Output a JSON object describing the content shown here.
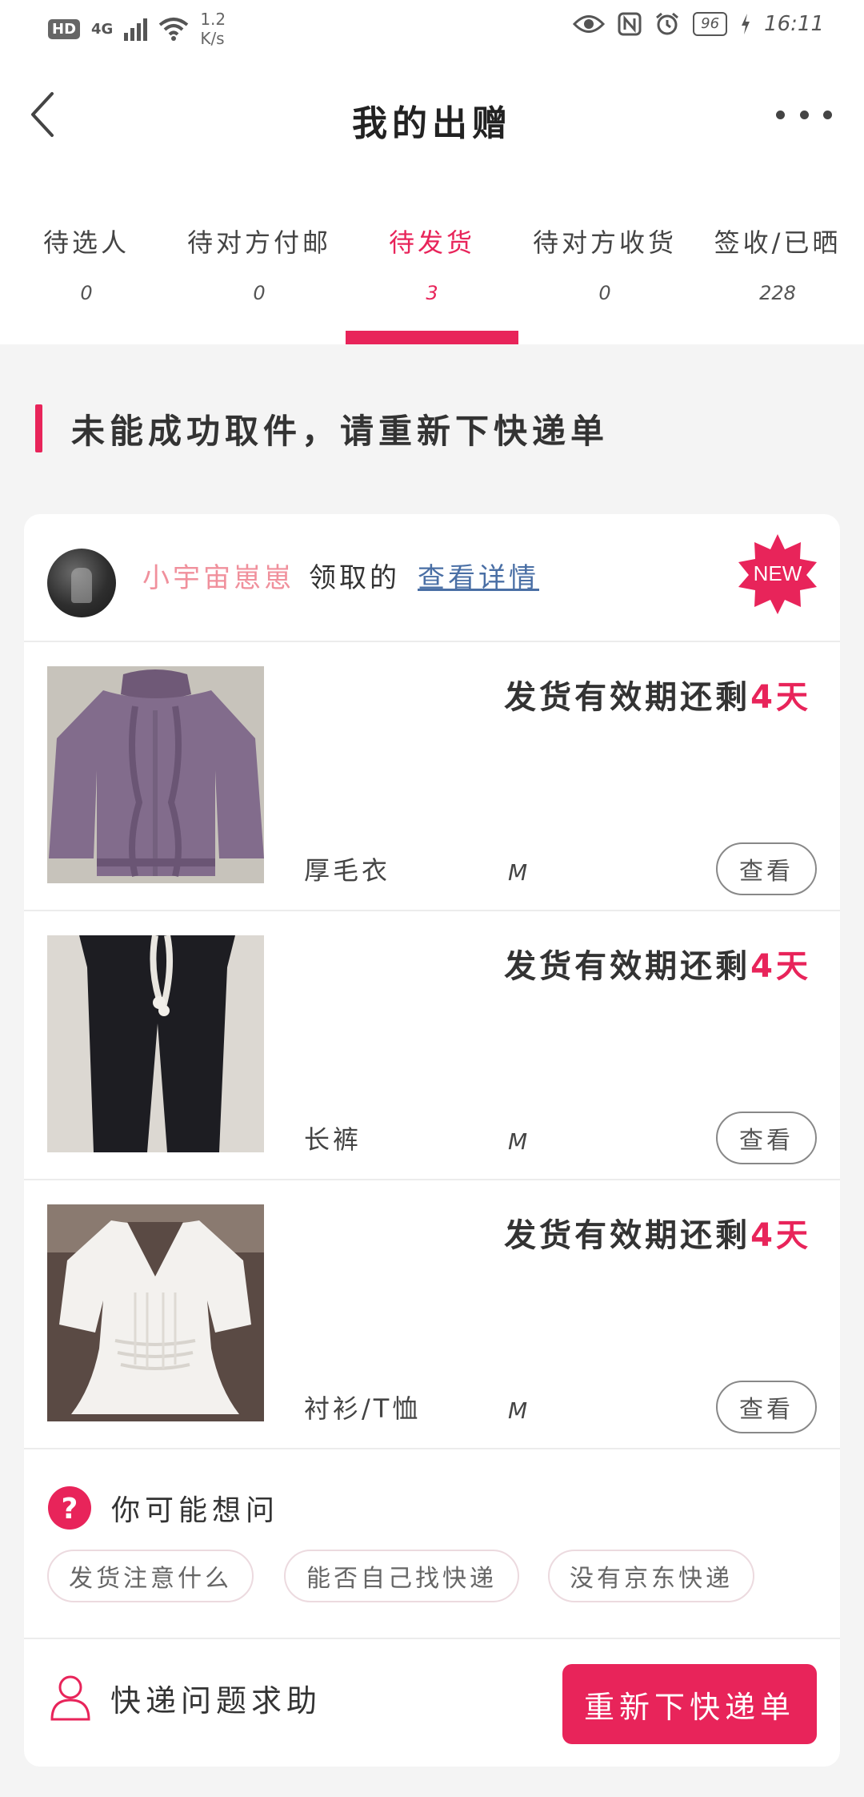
{
  "status_bar": {
    "hd": "HD",
    "network": "4G",
    "speed_value": "1.2",
    "speed_unit": "K/s",
    "battery": "96",
    "time": "16:11"
  },
  "header": {
    "title": "我的出赠"
  },
  "tabs": [
    {
      "label": "待选人",
      "count": "0"
    },
    {
      "label": "待对方付邮",
      "count": "0"
    },
    {
      "label": "待发货",
      "count": "3",
      "active": true
    },
    {
      "label": "待对方收货",
      "count": "0"
    },
    {
      "label": "签收/已晒",
      "count": "228"
    }
  ],
  "notice": {
    "text": "未能成功取件，请重新下快递单"
  },
  "order": {
    "nickname": "小宇宙崽崽",
    "claimed_text": "领取的",
    "detail_link": "查看详情",
    "badge": "NEW",
    "items": [
      {
        "expiry_prefix": "发货有效期还剩",
        "expiry_days": "4天",
        "name": "厚毛衣",
        "size": "M",
        "view_label": "查看",
        "photo": "purple-sweater"
      },
      {
        "expiry_prefix": "发货有效期还剩",
        "expiry_days": "4天",
        "name": "长裤",
        "size": "M",
        "view_label": "查看",
        "photo": "black-pants"
      },
      {
        "expiry_prefix": "发货有效期还剩",
        "expiry_days": "4天",
        "name": "衬衫/T恤",
        "size": "M",
        "view_label": "查看",
        "photo": "white-blouse"
      }
    ]
  },
  "faq": {
    "title": "你可能想问",
    "chips": [
      "发货注意什么",
      "能否自己找快递",
      "没有京东快递"
    ]
  },
  "footer": {
    "help_label": "快递问题求助",
    "action_label": "重新下快递单"
  },
  "colors": {
    "accent": "#e8245a",
    "nickname": "#f0909c",
    "link": "#4a6fa5"
  }
}
